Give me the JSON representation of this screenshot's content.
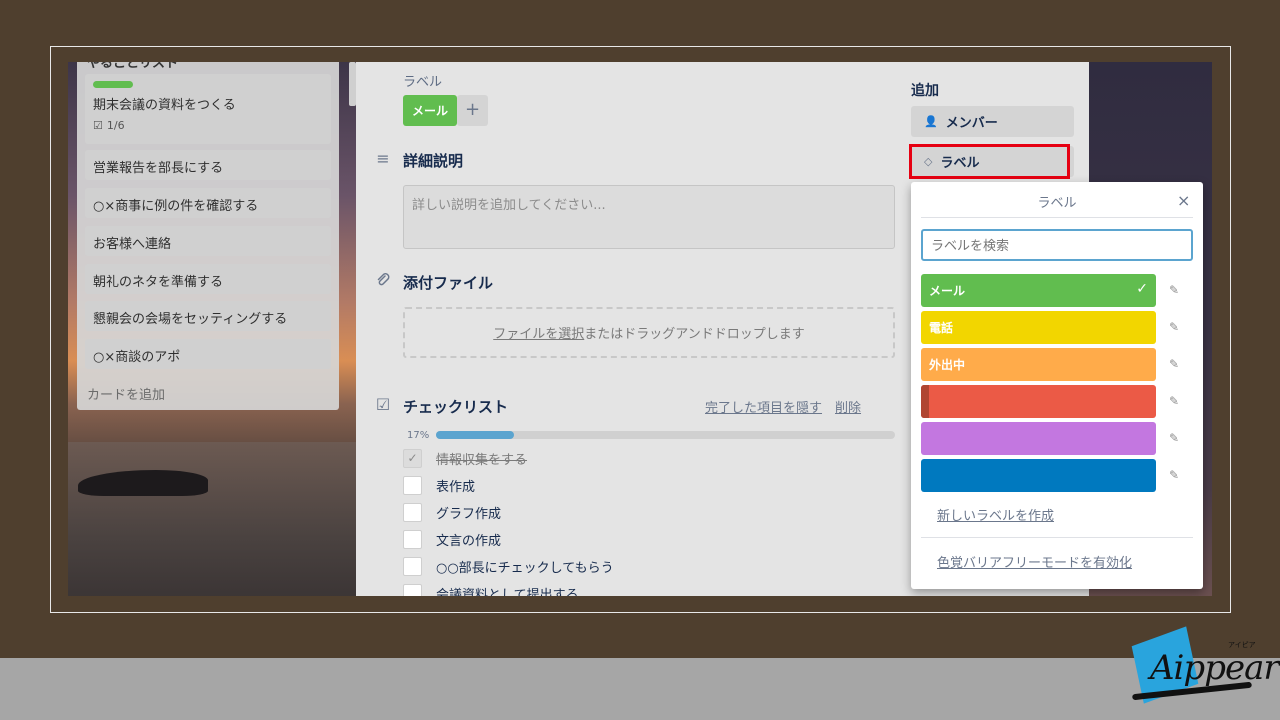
{
  "list": {
    "title_cut": "やることリスト",
    "cards": [
      {
        "title": "期末会議の資料をつくる",
        "badge": "1/6"
      },
      {
        "title": "営業報告を部長にする"
      },
      {
        "title": "○×商事に例の件を確認する"
      },
      {
        "title": "お客様へ連絡"
      },
      {
        "title": "朝礼のネタを準備する"
      },
      {
        "title": "懇親会の会場をセッティングする"
      },
      {
        "title": "○×商談のアポ"
      }
    ],
    "add_card": "カードを追加"
  },
  "detail": {
    "labels_heading": "ラベル",
    "label_chip": "メール",
    "label_add": "+",
    "description_heading": "詳細説明",
    "description_placeholder": "詳しい説明を追加してください...",
    "attachment_heading": "添付ファイル",
    "attachment_link": "ファイルを選択",
    "attachment_text": "またはドラッグアンドドロップします",
    "checklist_heading": "チェックリスト",
    "hide_completed": "完了した項目を隠す",
    "delete": "削除",
    "progress_label": "17%",
    "progress": 0.17,
    "items": [
      {
        "text": "情報収集をする",
        "done": true
      },
      {
        "text": "表作成",
        "done": false
      },
      {
        "text": "グラフ作成",
        "done": false
      },
      {
        "text": "文言の作成",
        "done": false
      },
      {
        "text": "○○部長にチェックしてもらう",
        "done": false
      },
      {
        "text": "会議資料として提出する",
        "done": false
      }
    ]
  },
  "sidebar": {
    "add_title": "追加",
    "member_button": "メンバー",
    "label_button": "ラベル"
  },
  "popover": {
    "title": "ラベル",
    "close": "×",
    "search_placeholder": "ラベルを検索",
    "labels": [
      {
        "name": "メール",
        "color": "#61bd4f",
        "selected": true
      },
      {
        "name": "電話",
        "color": "#f2d600",
        "selected": false
      },
      {
        "name": "外出中",
        "color": "#ffab4a",
        "selected": false
      },
      {
        "name": "",
        "color": "#eb5a46",
        "selected": false
      },
      {
        "name": "",
        "color": "#c377e0",
        "selected": false
      },
      {
        "name": "",
        "color": "#0079bf",
        "selected": false
      }
    ],
    "create_label": "新しいラベルを作成",
    "colorblind_mode": "色覚バリアフリーモードを有効化"
  },
  "logo": {
    "word": "Aippear",
    "kana": "アイピア"
  },
  "colors": {
    "highlight": "#e60012",
    "accent": "#5ba4cf"
  }
}
